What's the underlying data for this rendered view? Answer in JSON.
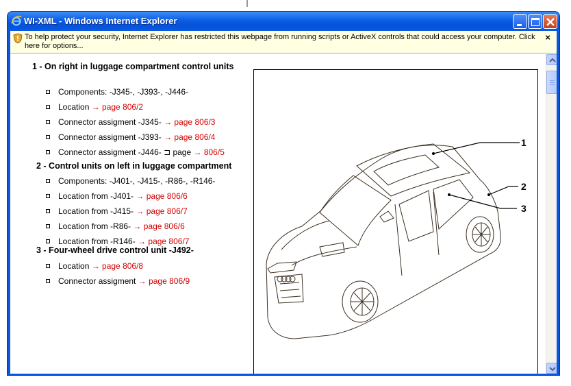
{
  "window": {
    "title": "WI-XML - Windows Internet Explorer"
  },
  "infobar": {
    "message": "To help protect your security, Internet Explorer has restricted this webpage from running scripts or ActiveX controls that could access your computer. Click here for options...",
    "close_glyph": "×"
  },
  "sections": [
    {
      "heading": "1 - On right in luggage compartment control units",
      "items": [
        {
          "text": "Components: -J345-, -J393-, -J446-",
          "ref": ""
        },
        {
          "text": "Location ",
          "ref": "→ page 806/2"
        },
        {
          "text": "Connector assigment -J345- ",
          "ref": "→ page 806/3"
        },
        {
          "text": "Connector assigment -J393- ",
          "ref": "→ page 806/4"
        },
        {
          "text": "Connector assigment -J446- ⊐ page ",
          "ref": "→ 806/5"
        }
      ]
    },
    {
      "heading": "2 - Control units on left in luggage compartment",
      "items": [
        {
          "text": "Components: -J401-, -J415-, -R86-, -R146-",
          "ref": ""
        },
        {
          "text": "Location from -J401- ",
          "ref": "→ page 806/6"
        },
        {
          "text": "Location from -J415- ",
          "ref": "→ page 806/7"
        },
        {
          "text": "Location from -R86- ",
          "ref": "→ page 806/6"
        },
        {
          "text": "Location from -R146- ",
          "ref": "→ page 806/7"
        }
      ]
    },
    {
      "heading": "3 - Four-wheel drive control unit -J492-",
      "items": [
        {
          "text": "Location ",
          "ref": "→ page 806/8"
        },
        {
          "text": "Connector assigment ",
          "ref": "→ page 806/9"
        }
      ]
    }
  ],
  "figure": {
    "callouts": [
      "1",
      "2",
      "3"
    ]
  },
  "colors": {
    "link_red": "#d40000",
    "infobar_bg": "#ffffe1",
    "titlebar_blue": "#0b5ee6"
  },
  "icons": {
    "title": "ie-logo-icon",
    "info": "shield-warning-icon",
    "minimize": "minimize-icon",
    "maximize": "maximize-icon",
    "close": "close-icon"
  }
}
